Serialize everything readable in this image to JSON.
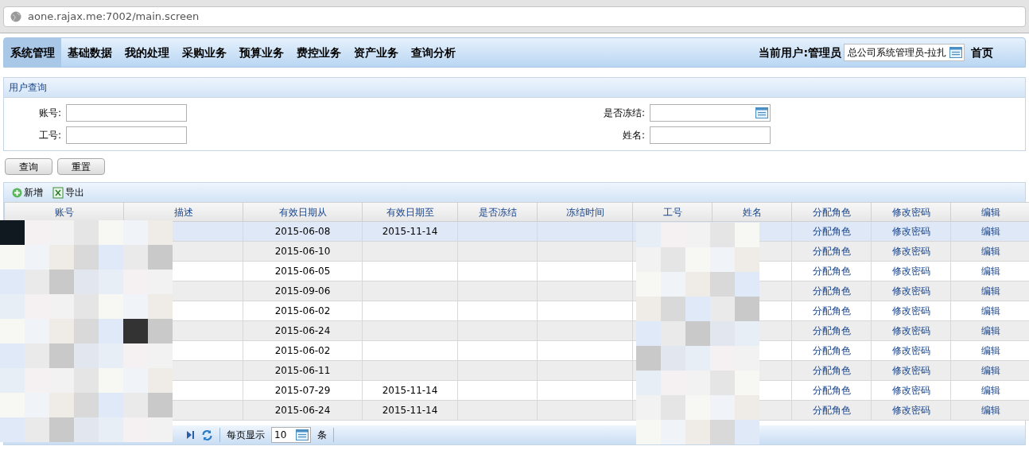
{
  "address_bar": {
    "url": "aone.rajax.me:7002/main.screen"
  },
  "nav": {
    "items": [
      {
        "label": "系统管理",
        "selected": true
      },
      {
        "label": "基础数据",
        "selected": false
      },
      {
        "label": "我的处理",
        "selected": false
      },
      {
        "label": "采购业务",
        "selected": false
      },
      {
        "label": "预算业务",
        "selected": false
      },
      {
        "label": "费控业务",
        "selected": false
      },
      {
        "label": "资产业务",
        "selected": false
      },
      {
        "label": "查询分析",
        "selected": false
      }
    ],
    "current_user_label": "当前用户:管理员",
    "org_select": {
      "value": "总公司系统管理员-拉扎"
    },
    "home_link": "首页"
  },
  "query_panel": {
    "title": "用户查询",
    "fields": [
      {
        "label": "账号:",
        "kind": "text"
      },
      {
        "label": "是否冻结:",
        "kind": "select"
      },
      {
        "label": "工号:",
        "kind": "text"
      },
      {
        "label": "姓名:",
        "kind": "text"
      }
    ],
    "buttons": [
      "查询",
      "重置"
    ]
  },
  "toolbar": [
    {
      "label": "新增",
      "kind": "add"
    },
    {
      "label": "导出",
      "kind": "export"
    }
  ],
  "table": {
    "columns": [
      "账号",
      "描述",
      "有效日期从",
      "有效日期至",
      "是否冻结",
      "冻结时间",
      "工号",
      "姓名",
      "分配角色",
      "修改密码",
      "编辑"
    ],
    "rows": [
      {
        "valid_from": "2015-06-08",
        "valid_to": "2015-11-14",
        "selected": true,
        "actions": [
          "分配角色",
          "修改密码",
          "编辑"
        ]
      },
      {
        "valid_from": "2015-06-10",
        "selected": false,
        "actions": [
          "分配角色",
          "修改密码",
          "编辑"
        ]
      },
      {
        "valid_from": "2015-06-05",
        "selected": false,
        "actions": [
          "分配角色",
          "修改密码",
          "编辑"
        ]
      },
      {
        "valid_from": "2015-09-06",
        "selected": false,
        "actions": [
          "分配角色",
          "修改密码",
          "编辑"
        ]
      },
      {
        "valid_from": "2015-06-02",
        "selected": false,
        "actions": [
          "分配角色",
          "修改密码",
          "编辑"
        ]
      },
      {
        "valid_from": "2015-06-24",
        "selected": false,
        "actions": [
          "分配角色",
          "修改密码",
          "编辑"
        ]
      },
      {
        "valid_from": "2015-06-02",
        "selected": false,
        "actions": [
          "分配角色",
          "修改密码",
          "编辑"
        ]
      },
      {
        "valid_from": "2015-06-11",
        "selected": false,
        "actions": [
          "分配角色",
          "修改密码",
          "编辑"
        ]
      },
      {
        "valid_from": "2015-07-29",
        "valid_to": "2015-11-14",
        "selected": false,
        "actions": [
          "分配角色",
          "修改密码",
          "编辑"
        ]
      },
      {
        "valid_from": "2015-06-24",
        "valid_to": "2015-11-14",
        "selected": false,
        "actions": [
          "分配角色",
          "修改密码",
          "编辑"
        ]
      }
    ]
  },
  "pager": {
    "per_page_label": "每页显示",
    "per_page": "10",
    "unit": "条"
  }
}
